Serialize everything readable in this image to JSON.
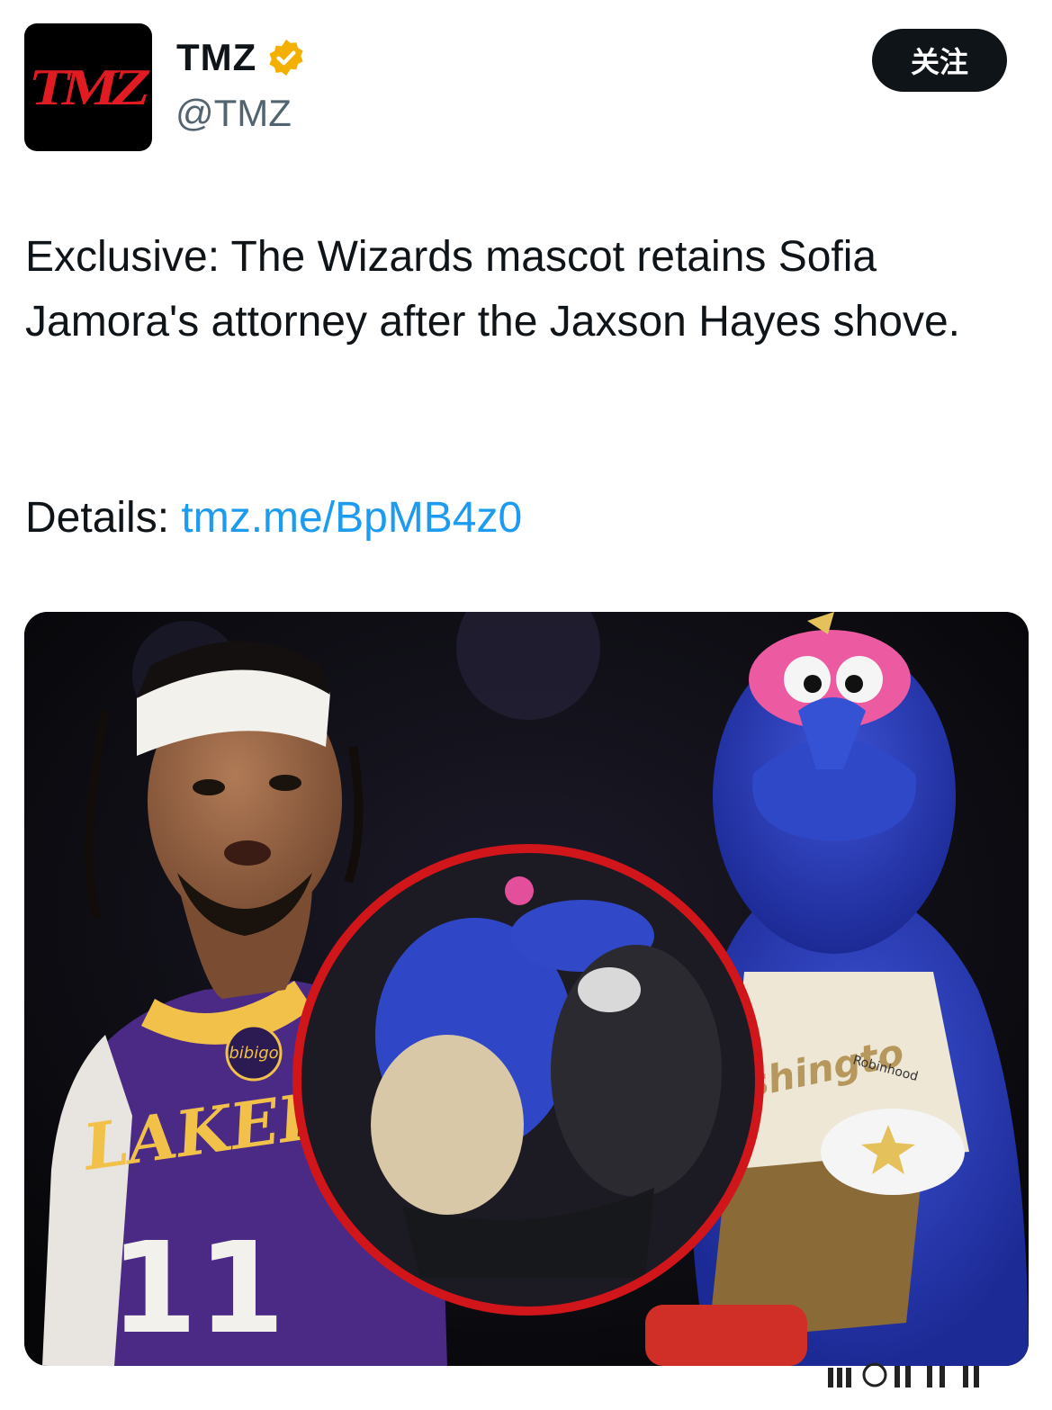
{
  "author": {
    "display_name": "TMZ",
    "handle": "@TMZ",
    "avatar_text": "TMZ",
    "verified_icon": "verified-badge-icon",
    "verified_color": "#f4b000"
  },
  "follow_button": {
    "label": "关注"
  },
  "tweet": {
    "text": "Exclusive: The Wizards mascot retains Sofia Jamora's attorney after the Jaxson Hayes shove.",
    "details_label": "Details: ",
    "link_text": "tmz.me/BpMB4z0",
    "link_color": "#1d9bf0"
  },
  "media": {
    "jersey_brand": "LAKERS",
    "jersey_number": "11",
    "jersey_patch": "bibigo",
    "mascot_jersey_text": "shingto",
    "mascot_sponsor": "Robinhood",
    "highlight_ring_color": "#d0161b"
  }
}
